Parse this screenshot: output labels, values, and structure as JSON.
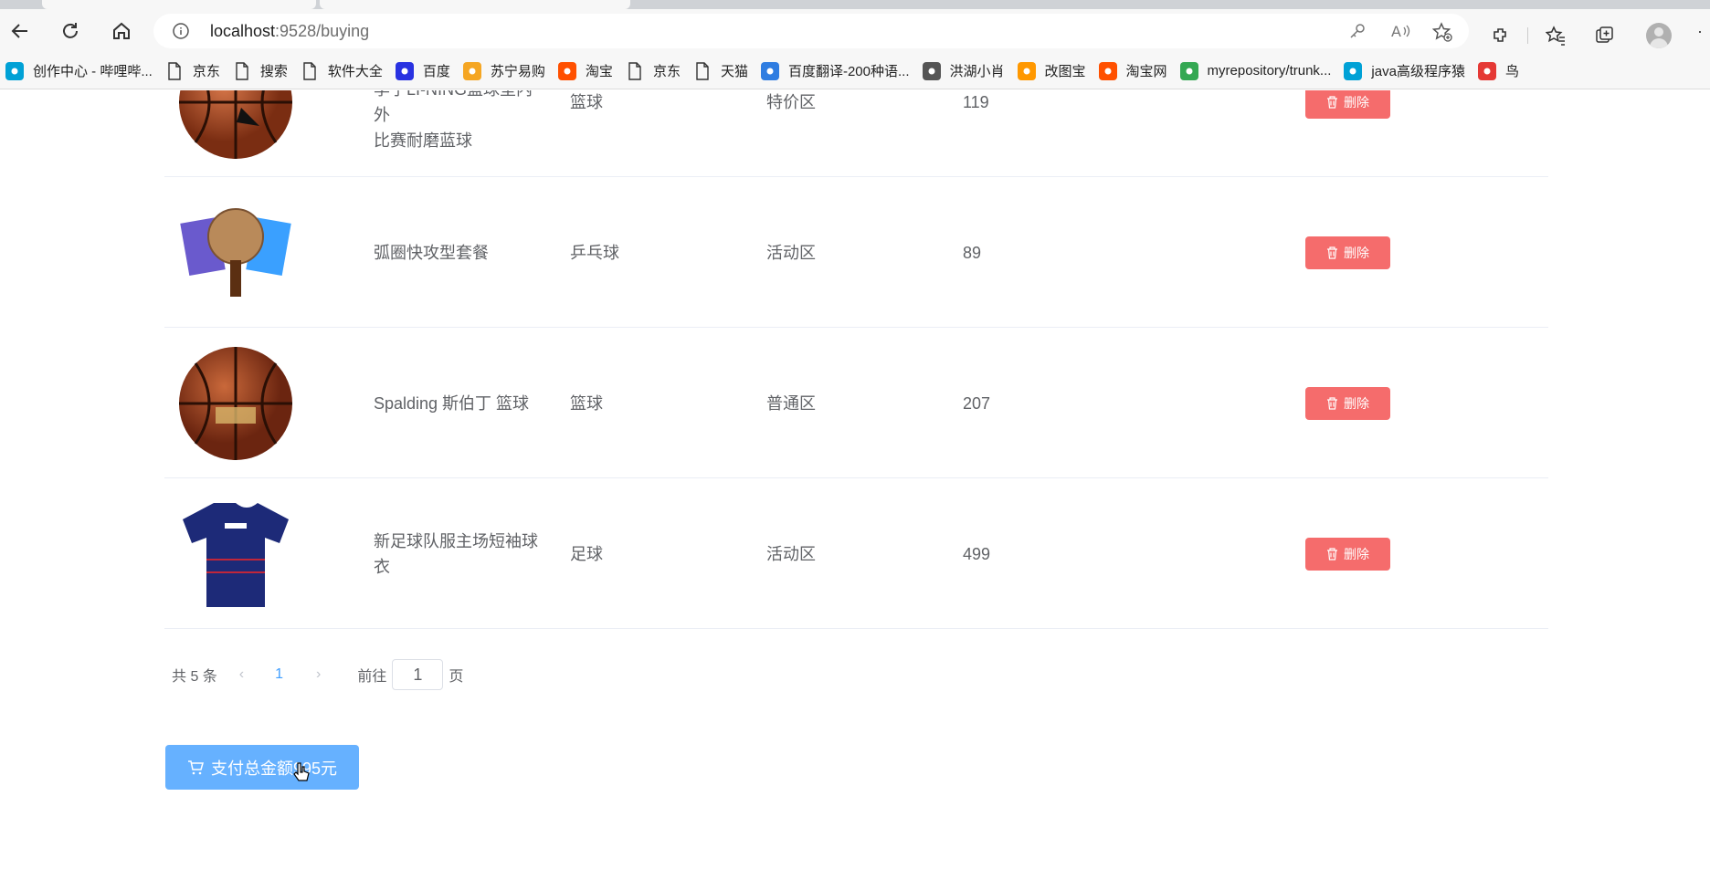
{
  "browser": {
    "url_host": "localhost",
    "url_rest": ":9528/buying"
  },
  "bookmarks": [
    {
      "label": "创作中心 - 哔哩哔...",
      "icon": "bilibili-icon",
      "color": "#00a1d6"
    },
    {
      "label": "京东",
      "icon": "page-icon",
      "color": ""
    },
    {
      "label": "搜索",
      "icon": "page-icon",
      "color": ""
    },
    {
      "label": "软件大全",
      "icon": "page-icon",
      "color": ""
    },
    {
      "label": "百度",
      "icon": "baidu-paw-icon",
      "color": "#2932e1"
    },
    {
      "label": "苏宁易购",
      "icon": "suning-icon",
      "color": "#f5a623"
    },
    {
      "label": "淘宝",
      "icon": "taobao-icon",
      "color": "#ff5000"
    },
    {
      "label": "京东",
      "icon": "page-icon",
      "color": ""
    },
    {
      "label": "天猫",
      "icon": "page-icon",
      "color": ""
    },
    {
      "label": "百度翻译-200种语...",
      "icon": "translate-icon",
      "color": "#2f7de1"
    },
    {
      "label": "洪湖小肖",
      "icon": "bird-icon",
      "color": "#555555"
    },
    {
      "label": "改图宝",
      "icon": "gaitubao-icon",
      "color": "#ff9800"
    },
    {
      "label": "淘宝网",
      "icon": "taobao-icon",
      "color": "#ff5000"
    },
    {
      "label": "myrepository/trunk...",
      "icon": "chrome-icon",
      "color": "#34a853"
    },
    {
      "label": "java高级程序猿",
      "icon": "bilibili-icon",
      "color": "#00a1d6"
    },
    {
      "label": "鸟",
      "icon": "bird-icon",
      "color": "#e53935"
    }
  ],
  "rows": [
    {
      "name_line1": "李宁LI-NING篮球室内外",
      "name_line2": "比赛耐磨蓝球",
      "category": "篮球",
      "zone": "特价区",
      "price": "119",
      "delete_label": "删除",
      "image": "basketball-lining"
    },
    {
      "name_line1": "弧圈快攻型套餐",
      "name_line2": "",
      "category": "乒乓球",
      "zone": "活动区",
      "price": "89",
      "delete_label": "删除",
      "image": "pingpong-paddle"
    },
    {
      "name_line1": "Spalding 斯伯丁 篮球",
      "name_line2": "",
      "category": "篮球",
      "zone": "普通区",
      "price": "207",
      "delete_label": "删除",
      "image": "basketball-spalding"
    },
    {
      "name_line1": "新足球队服主场短袖球",
      "name_line2": "衣",
      "category": "足球",
      "zone": "活动区",
      "price": "499",
      "delete_label": "删除",
      "image": "soccer-jersey"
    }
  ],
  "pagination": {
    "total": "共 5 条",
    "current_page": "1",
    "goto_label": "前往",
    "goto_value": "1",
    "page_suffix": "页"
  },
  "pay_button": {
    "label": "支付总金额995元"
  },
  "colors": {
    "danger": "#f56c6c",
    "primary_light": "#66b1ff",
    "primary": "#409eff"
  }
}
